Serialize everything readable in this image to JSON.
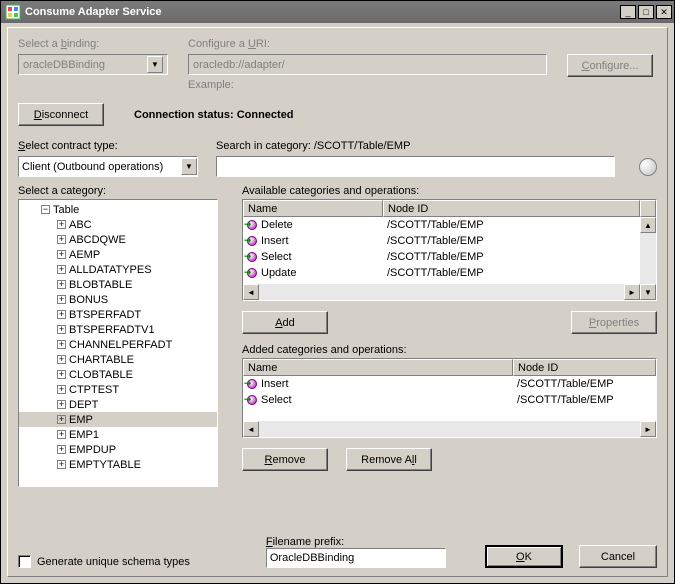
{
  "title": "Consume Adapter Service",
  "labels": {
    "select_binding": "Select a binding:",
    "configure_uri": "Configure a URI:",
    "example": "Example:",
    "connection_status_label": "Connection status:",
    "connection_status_value": "Connected",
    "select_contract": "Select contract type:",
    "search_in_category": "Search in category: /SCOTT/Table/EMP",
    "select_category": "Select a category:",
    "available_ops": "Available categories and operations:",
    "added_ops": "Added categories and operations:",
    "filename_prefix": "Filename prefix:",
    "generate_unique": "Generate unique schema types"
  },
  "buttons": {
    "configure": "Configure...",
    "disconnect": "Disconnect",
    "add": "Add",
    "properties": "Properties",
    "remove": "Remove",
    "remove_all": "Remove All",
    "ok": "OK",
    "cancel": "Cancel"
  },
  "binding": {
    "selected": "oracleDBBinding"
  },
  "uri": {
    "value": "oracledb://adapter/"
  },
  "contract": {
    "selected": "Client (Outbound operations)"
  },
  "filename": {
    "value": "OracleDBBinding"
  },
  "tree": {
    "root": "Table",
    "items": [
      "ABC",
      "ABCDQWE",
      "AEMP",
      "ALLDATATYPES",
      "BLOBTABLE",
      "BONUS",
      "BTSPERFADT",
      "BTSPERFADTV1",
      "CHANNELPERFADT",
      "CHARTABLE",
      "CLOBTABLE",
      "CTPTEST",
      "DEPT",
      "EMP",
      "EMP1",
      "EMPDUP",
      "EMPTYTABLE"
    ]
  },
  "available": {
    "columns": [
      "Name",
      "Node ID"
    ],
    "rows": [
      {
        "name": "Delete",
        "node": "/SCOTT/Table/EMP"
      },
      {
        "name": "Insert",
        "node": "/SCOTT/Table/EMP"
      },
      {
        "name": "Select",
        "node": "/SCOTT/Table/EMP"
      },
      {
        "name": "Update",
        "node": "/SCOTT/Table/EMP"
      }
    ]
  },
  "added": {
    "columns": [
      "Name",
      "Node ID"
    ],
    "rows": [
      {
        "name": "Insert",
        "node": "/SCOTT/Table/EMP"
      },
      {
        "name": "Select",
        "node": "/SCOTT/Table/EMP"
      }
    ]
  }
}
